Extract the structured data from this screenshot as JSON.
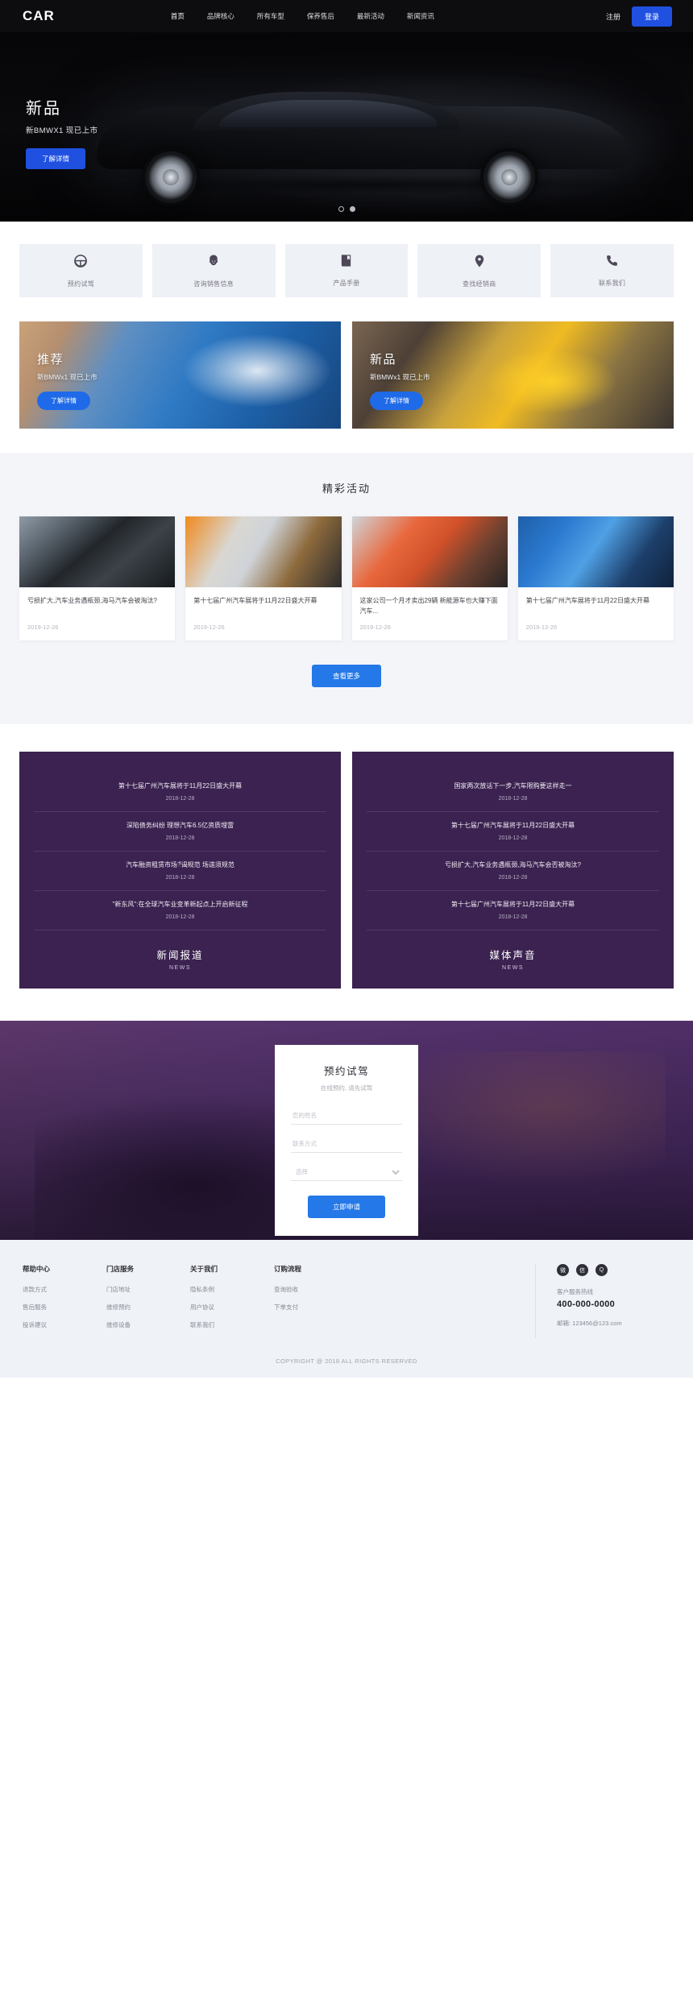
{
  "header": {
    "logo": "CAR",
    "nav": [
      {
        "label": "首页",
        "active": true
      },
      {
        "label": "品牌核心",
        "active": false
      },
      {
        "label": "所有车型",
        "active": false
      },
      {
        "label": "保养售后",
        "active": false
      },
      {
        "label": "最新活动",
        "active": false
      },
      {
        "label": "新闻资讯",
        "active": false
      }
    ],
    "register_label": "注册",
    "login_label": "登录",
    "accent_color": "#1f50e0"
  },
  "hero": {
    "title": "新品",
    "subtitle": "新BMWX1 现已上市",
    "button_label": "了解详情",
    "dots": 2,
    "active_dot": 1
  },
  "services": [
    {
      "icon": "steering-wheel-icon",
      "label": "预约试驾"
    },
    {
      "icon": "person-headset-icon",
      "label": "咨询销售信息"
    },
    {
      "icon": "book-icon",
      "label": "产品手册"
    },
    {
      "icon": "location-pin-icon",
      "label": "查找经销商"
    },
    {
      "icon": "phone-icon",
      "label": "联系我们"
    }
  ],
  "promos": [
    {
      "title": "推荐",
      "subtitle": "新BMWx1 现已上市",
      "button_label": "了解详情"
    },
    {
      "title": "新品",
      "subtitle": "新BMWx1 现已上市",
      "button_label": "了解详情"
    }
  ],
  "activities": {
    "title": "精彩活动",
    "more_label": "查看更多",
    "cards": [
      {
        "text": "亏损扩大,汽车业务遇瓶颈,海马汽车会被淘汰?",
        "date": "2019-12-26"
      },
      {
        "text": "第十七届广州汽车展将于11月22日盛大开幕",
        "date": "2019-12-26"
      },
      {
        "text": "这家公司一个月才卖出29辆 新能源车也大赚下面汽车...",
        "date": "2019-12-26"
      },
      {
        "text": "第十七届广州汽车展将于11月22日盛大开幕",
        "date": "2019-12-26"
      }
    ]
  },
  "news": {
    "left": {
      "heading_cn": "新闻报道",
      "heading_en": "NEWS",
      "items": [
        {
          "title": "第十七届广州汽车展将于11月22日盛大开幕",
          "date": "2018-12-28"
        },
        {
          "title": "深陷债务纠纷 理想汽车6.5亿资质埋雷",
          "date": "2018-12-28"
        },
        {
          "title": "汽车融资租赁市场ే谒规范 场遄须规范",
          "date": "2018-12-28"
        },
        {
          "title": "\"新东风\":在全球汽车业变革新起点上开启新征程",
          "date": "2018-12-28"
        }
      ]
    },
    "right": {
      "heading_cn": "媒体声音",
      "heading_en": "NEWS",
      "items": [
        {
          "title": "国家两次放话下一步,汽车限购要这样走一",
          "date": "2018-12-28"
        },
        {
          "title": "第十七届广州汽车展将于11月22日盛大开幕",
          "date": "2018-12-28"
        },
        {
          "title": "亏损扩大,汽车业务遇瓶颈,海马汽车会否被淘汰?",
          "date": "2018-12-28"
        },
        {
          "title": "第十七届广州汽车展将于11月22日盛大开幕",
          "date": "2018-12-28"
        }
      ]
    }
  },
  "booking": {
    "title": "预约试驾",
    "subtitle": "在线预约, 请先试驾",
    "fields": [
      {
        "name": "name",
        "placeholder": "您的姓名",
        "value": ""
      },
      {
        "name": "contact",
        "placeholder": "联系方式",
        "value": ""
      }
    ],
    "select": {
      "placeholder": "选择",
      "value": "选择"
    },
    "button_label": "立即申请"
  },
  "footer": {
    "columns": [
      {
        "head": "帮助中心",
        "links": [
          "退款方式",
          "售后服务",
          "投诉建议"
        ]
      },
      {
        "head": "门店服务",
        "links": [
          "门店地址",
          "维修预约",
          "维修设备"
        ]
      },
      {
        "head": "关于我们",
        "links": [
          "隐私条例",
          "用户协议",
          "联系我们"
        ]
      },
      {
        "head": "订购流程",
        "links": [
          "查询验收",
          "下单支付"
        ]
      }
    ],
    "socials": [
      "weibo-icon",
      "wechat-icon",
      "qq-icon"
    ],
    "hotline_label": "客户服务热线",
    "hotline": "400-000-0000",
    "mail": "邮箱: 123456@123.com",
    "copyright": "COPYRIGHT @ 2018  ALL RIGHTS RESERVED"
  }
}
